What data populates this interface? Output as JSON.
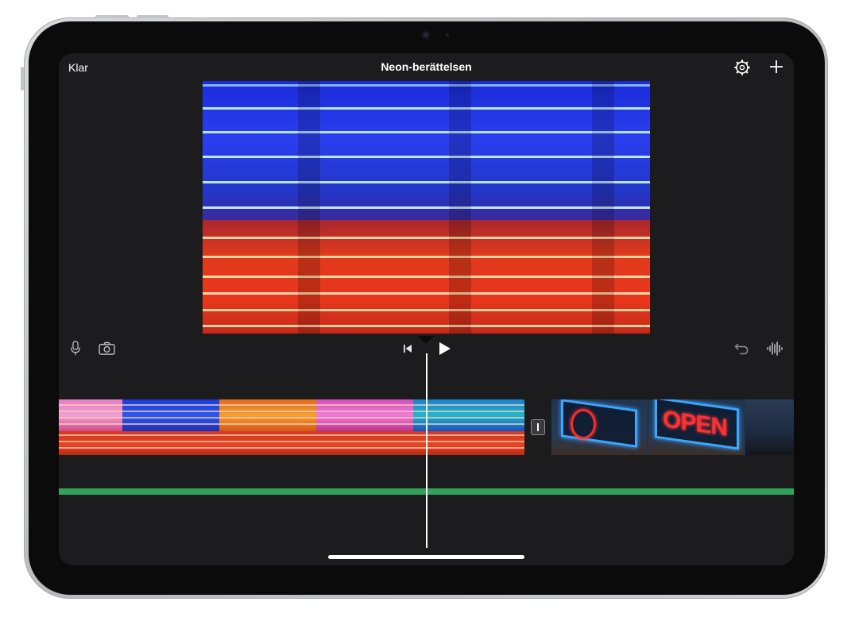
{
  "header": {
    "done_label": "Klar",
    "project_title": "Neon-berättelsen"
  },
  "toolbar": {
    "left_icons": [
      "microphone-icon",
      "camera-icon"
    ],
    "center_icons": [
      "skip-to-start-icon",
      "play-icon"
    ],
    "right_icons": [
      "undo-icon",
      "audio-waveform-icon"
    ]
  },
  "timeline": {
    "clips": [
      {
        "name": "neon-lines-clip",
        "frames": [
          "pink",
          "blue",
          "orange",
          "magenta",
          "teal"
        ]
      },
      {
        "name": "open-sign-clip",
        "frames": [
          "open-sign-o",
          "open-sign-open",
          "dark-city"
        ]
      }
    ],
    "audio_track_color": "#2fa35a"
  },
  "colors": {
    "screen_bg": "#1c1c1e",
    "accent_white": "#ffffff"
  }
}
